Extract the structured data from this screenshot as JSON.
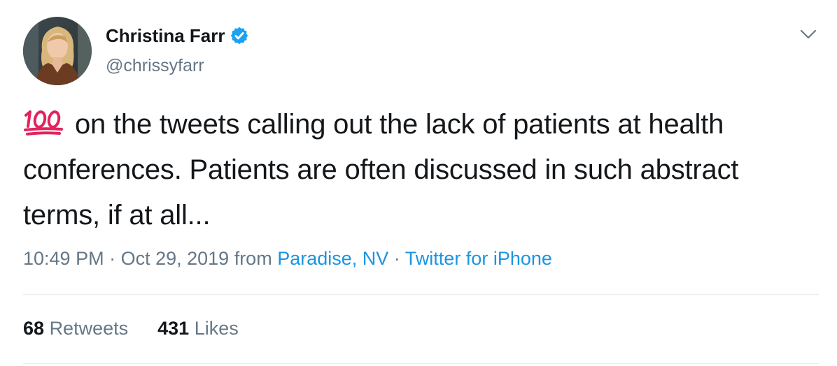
{
  "tweet": {
    "author": {
      "display_name": "Christina Farr",
      "handle": "@chrissyfarr",
      "verified": true
    },
    "text": "on the tweets calling out the lack of patients at health conferences. Patients are often discussed in such abstract terms, if at all...",
    "emoji": "100",
    "meta": {
      "time": "10:49 PM",
      "sep1": " · ",
      "date": "Oct 29, 2019",
      "from_word": " from ",
      "location": "Paradise, NV",
      "sep2": " · ",
      "source": "Twitter for iPhone"
    },
    "stats": {
      "retweets_count": "68",
      "retweets_label": "Retweets",
      "likes_count": "431",
      "likes_label": "Likes"
    }
  },
  "colors": {
    "text": "#14171a",
    "secondary": "#657786",
    "link": "#1b95e0",
    "verified_badge": "#1da1f2",
    "emoji_red": "#e0245e",
    "divider": "#e6ecf0"
  },
  "icons": {
    "verified": "verified-badge-icon",
    "caret": "chevron-down-icon",
    "emoji": "hundred-points-emoji"
  }
}
